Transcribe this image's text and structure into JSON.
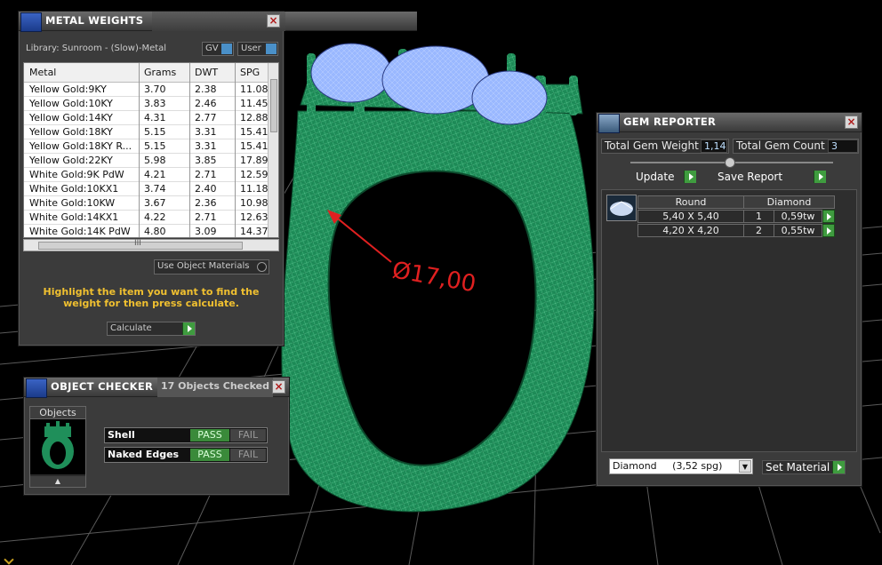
{
  "viewport": {
    "dimension_label": "Ø17,00"
  },
  "metal_weights": {
    "title": "METAL WEIGHTS",
    "library_label": "Library: Sunroom - (Slow)-Metal",
    "gv_label": "GV",
    "user_label": "User",
    "columns": [
      "Metal",
      "Grams",
      "DWT",
      "SPG"
    ],
    "rows": [
      [
        "Yellow Gold:9KY",
        "3.70",
        "2.38",
        "11.08"
      ],
      [
        "Yellow Gold:10KY",
        "3.83",
        "2.46",
        "11.45"
      ],
      [
        "Yellow Gold:14KY",
        "4.31",
        "2.77",
        "12.88"
      ],
      [
        "Yellow Gold:18KY",
        "5.15",
        "3.31",
        "15.41"
      ],
      [
        "Yellow Gold:18KY R...",
        "5.15",
        "3.31",
        "15.41"
      ],
      [
        "Yellow Gold:22KY",
        "5.98",
        "3.85",
        "17.89"
      ],
      [
        "White Gold:9K PdW",
        "4.21",
        "2.71",
        "12.59"
      ],
      [
        "White Gold:10KX1",
        "3.74",
        "2.40",
        "11.18"
      ],
      [
        "White Gold:10KW",
        "3.67",
        "2.36",
        "10.98"
      ],
      [
        "White Gold:14KX1",
        "4.22",
        "2.71",
        "12.63"
      ],
      [
        "White Gold:14K PdW",
        "4.80",
        "3.09",
        "14.37"
      ]
    ],
    "hscroll_grip": "III",
    "use_object_materials": "Use Object Materials",
    "hint": "Highlight the item you want to find the weight for then press calculate.",
    "calculate_label": "Calculate"
  },
  "object_checker": {
    "title": "OBJECT CHECKER",
    "count_label": "17  Objects Checked",
    "objects_label": "Objects",
    "checks": [
      {
        "label": "Shell",
        "pass": "PASS",
        "fail": "FAIL"
      },
      {
        "label": "Naked Edges",
        "pass": "PASS",
        "fail": "FAIL"
      }
    ]
  },
  "gem_reporter": {
    "title": "GEM REPORTER",
    "total_weight_label": "Total Gem Weight",
    "total_weight_value": "1,14",
    "total_count_label": "Total Gem Count",
    "total_count_value": "3",
    "update_label": "Update",
    "save_report_label": "Save Report",
    "table_headers": [
      "Round",
      "Diamond"
    ],
    "rows": [
      {
        "size": "5,40 X 5,40",
        "qty": "1",
        "weight": "0,59tw"
      },
      {
        "size": "4,20 X 4,20",
        "qty": "2",
        "weight": "0,55tw"
      }
    ],
    "material_select": "Diamond     (3,52 spg)",
    "set_material_label": "Set Material"
  },
  "colors": {
    "ring_green": "#1f8f5a",
    "gem_blue": "#9ab8ff",
    "hint_yellow": "#f0c030",
    "pass_green": "#3a8a3a",
    "dimension_red": "#e02020"
  }
}
